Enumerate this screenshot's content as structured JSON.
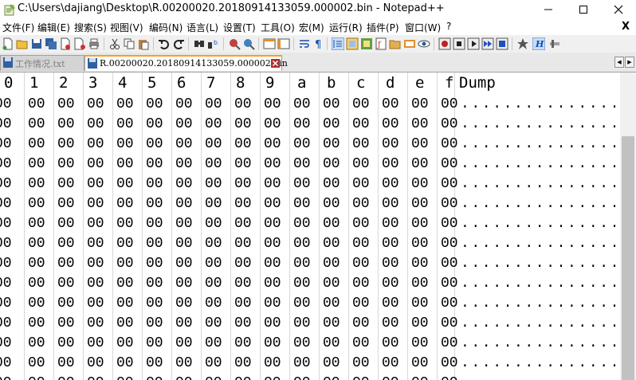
{
  "window": {
    "title": "C:\\Users\\dajiang\\Desktop\\R.00200020.20180914133059.000002.bin - Notepad++",
    "minimize_glyph": "—",
    "maximize_glyph": "☐",
    "close_glyph": "✕"
  },
  "menu": {
    "items": [
      "文件(F)",
      "编辑(E)",
      "搜索(S)",
      "视图(V)",
      "编码(N)",
      "语言(L)",
      "设置(T)",
      "工具(O)",
      "宏(M)",
      "运行(R)",
      "插件(P)",
      "窗口(W)",
      "?"
    ],
    "close_glyph": "X"
  },
  "tabs": [
    {
      "label": "工作情况.txt",
      "active": false
    },
    {
      "label": "R.00200020.20180914133059.000002.bin",
      "active": true
    }
  ],
  "hex_view": {
    "headers": [
      "0",
      "1",
      "2",
      "3",
      "4",
      "5",
      "6",
      "7",
      "8",
      "9",
      "a",
      "b",
      "c",
      "d",
      "e",
      "f",
      "Dump"
    ],
    "row_bytes": [
      "00",
      "00",
      "00",
      "00",
      "00",
      "00",
      "00",
      "00",
      "00",
      "00",
      "00",
      "00",
      "00",
      "00",
      "00",
      "00"
    ],
    "row_dump": "...............",
    "visible_rows": 15
  },
  "colors": {
    "tab_active_accent": "#f4a21b",
    "tab_close": "#b03030",
    "grid_line": "#d8d8d8"
  }
}
